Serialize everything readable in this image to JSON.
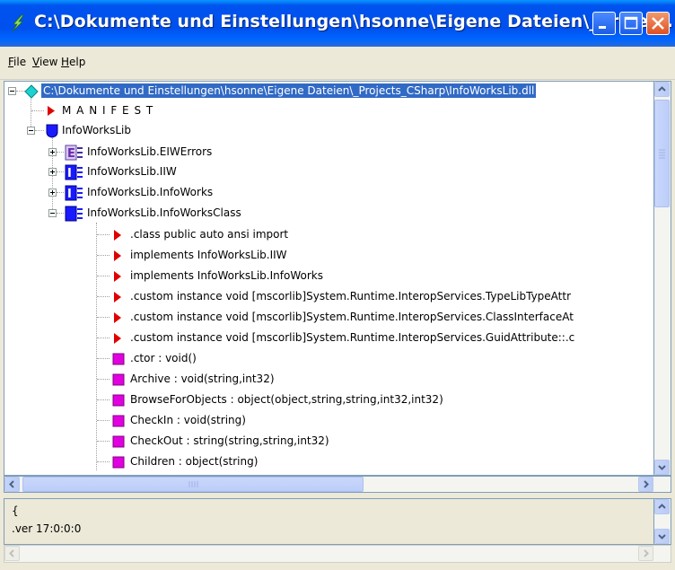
{
  "window": {
    "title": "C:\\Dokumente und Einstellungen\\hsonne\\Eigene Dateien\\_Project...",
    "colors": {
      "titlebar": "#0053ee",
      "selection": "#316ac5",
      "class_icon": "#1a1aff",
      "method_icon": "#cc00cc",
      "directive_icon": "#e00000"
    }
  },
  "menu": {
    "file": {
      "mnemonic": "F",
      "rest": "ile"
    },
    "view": {
      "mnemonic": "V",
      "rest": "iew"
    },
    "help": {
      "mnemonic": "H",
      "rest": "elp"
    }
  },
  "tree": {
    "root_label": "C:\\Dokumente und Einstellungen\\hsonne\\Eigene Dateien\\_Projects_CSharp\\InfoWorksLib.dll",
    "manifest_label": "M A N I F E S T",
    "namespace_label": "InfoWorksLib",
    "types": [
      {
        "label": "InfoWorksLib.EIWErrors",
        "icon": "enum-icon",
        "glyph": "E"
      },
      {
        "label": "InfoWorksLib.IIW",
        "icon": "interface-icon",
        "glyph": "I"
      },
      {
        "label": "InfoWorksLib.InfoWorks",
        "icon": "interface-icon",
        "glyph": "I"
      },
      {
        "label": "InfoWorksLib.InfoWorksClass",
        "icon": "class-icon",
        "glyph": ""
      }
    ],
    "class_members": [
      {
        "label": ".class public auto ansi import",
        "kind": "directive"
      },
      {
        "label": "implements InfoWorksLib.IIW",
        "kind": "directive"
      },
      {
        "label": "implements InfoWorksLib.InfoWorks",
        "kind": "directive"
      },
      {
        "label": ".custom instance void [mscorlib]System.Runtime.InteropServices.TypeLibTypeAttr",
        "kind": "directive"
      },
      {
        "label": ".custom instance void [mscorlib]System.Runtime.InteropServices.ClassInterfaceAt",
        "kind": "directive"
      },
      {
        "label": ".custom instance void [mscorlib]System.Runtime.InteropServices.GuidAttribute::.c",
        "kind": "directive"
      },
      {
        "label": ".ctor : void()",
        "kind": "method"
      },
      {
        "label": "Archive : void(string,int32)",
        "kind": "method"
      },
      {
        "label": "BrowseForObjects : object(object,string,string,int32,int32)",
        "kind": "method"
      },
      {
        "label": "CheckIn : void(string)",
        "kind": "method"
      },
      {
        "label": "CheckOut : string(string,string,int32)",
        "kind": "method"
      },
      {
        "label": "Children : object(string)",
        "kind": "method"
      }
    ]
  },
  "detail": {
    "line1": "{",
    "line2": ".ver 17:0:0:0"
  }
}
